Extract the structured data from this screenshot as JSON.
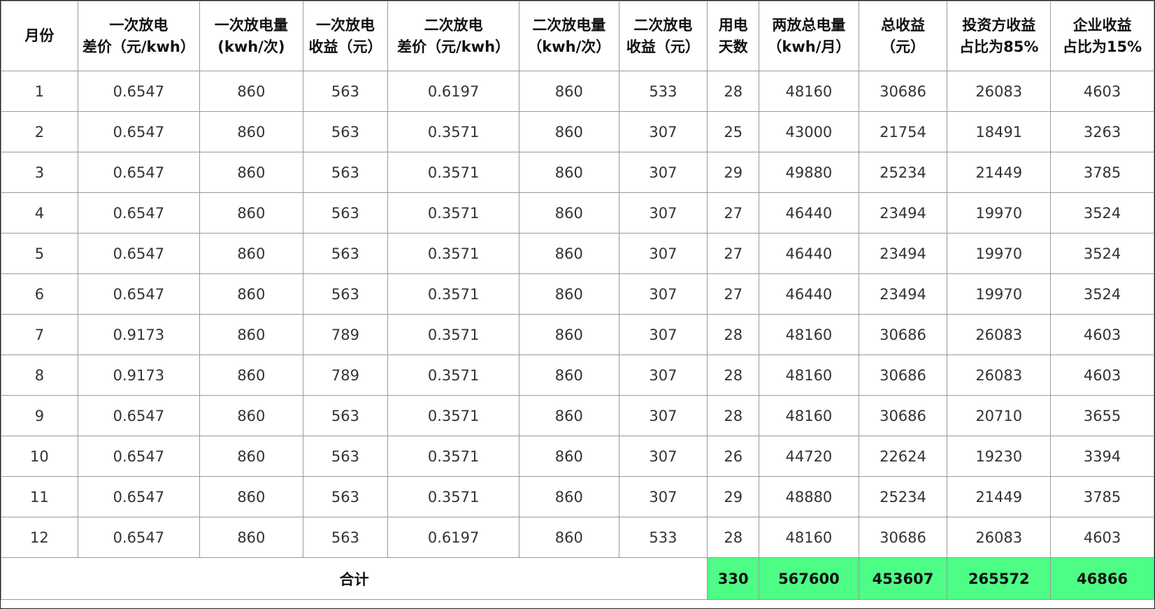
{
  "table": {
    "headers": [
      [
        "月份"
      ],
      [
        "一次放电",
        "差价（元/kwh）"
      ],
      [
        "一次放电量",
        "(kwh/次)"
      ],
      [
        "一次放电",
        "收益（元）"
      ],
      [
        "二次放电",
        "差价（元/kwh）"
      ],
      [
        "二次放电量",
        "（kwh/次）"
      ],
      [
        "二次放电",
        "收益（元）"
      ],
      [
        "用电",
        "天数"
      ],
      [
        "两放总电量",
        "（kwh/月）"
      ],
      [
        "总收益",
        "（元）"
      ],
      [
        "投资方收益",
        "占比为85%"
      ],
      [
        "企业收益",
        "占比为15%"
      ]
    ],
    "rows": [
      [
        "1",
        "0.6547",
        "860",
        "563",
        "0.6197",
        "860",
        "533",
        "28",
        "48160",
        "30686",
        "26083",
        "4603"
      ],
      [
        "2",
        "0.6547",
        "860",
        "563",
        "0.3571",
        "860",
        "307",
        "25",
        "43000",
        "21754",
        "18491",
        "3263"
      ],
      [
        "3",
        "0.6547",
        "860",
        "563",
        "0.3571",
        "860",
        "307",
        "29",
        "49880",
        "25234",
        "21449",
        "3785"
      ],
      [
        "4",
        "0.6547",
        "860",
        "563",
        "0.3571",
        "860",
        "307",
        "27",
        "46440",
        "23494",
        "19970",
        "3524"
      ],
      [
        "5",
        "0.6547",
        "860",
        "563",
        "0.3571",
        "860",
        "307",
        "27",
        "46440",
        "23494",
        "19970",
        "3524"
      ],
      [
        "6",
        "0.6547",
        "860",
        "563",
        "0.3571",
        "860",
        "307",
        "27",
        "46440",
        "23494",
        "19970",
        "3524"
      ],
      [
        "7",
        "0.9173",
        "860",
        "789",
        "0.3571",
        "860",
        "307",
        "28",
        "48160",
        "30686",
        "26083",
        "4603"
      ],
      [
        "8",
        "0.9173",
        "860",
        "789",
        "0.3571",
        "860",
        "307",
        "28",
        "48160",
        "30686",
        "26083",
        "4603"
      ],
      [
        "9",
        "0.6547",
        "860",
        "563",
        "0.3571",
        "860",
        "307",
        "28",
        "48160",
        "30686",
        "20710",
        "3655"
      ],
      [
        "10",
        "0.6547",
        "860",
        "563",
        "0.3571",
        "860",
        "307",
        "26",
        "44720",
        "22624",
        "19230",
        "3394"
      ],
      [
        "11",
        "0.6547",
        "860",
        "563",
        "0.3571",
        "860",
        "307",
        "29",
        "48880",
        "25234",
        "21449",
        "3785"
      ],
      [
        "12",
        "0.6547",
        "860",
        "563",
        "0.6197",
        "860",
        "533",
        "28",
        "48160",
        "30686",
        "26083",
        "4603"
      ]
    ],
    "total": {
      "label": "合计",
      "days": "330",
      "total_energy": "567600",
      "total_revenue": "453607",
      "investor_revenue": "265572",
      "enterprise_revenue": "46866"
    }
  },
  "colors": {
    "highlight": "#4dfd86",
    "grid": "#9a9a9a"
  }
}
